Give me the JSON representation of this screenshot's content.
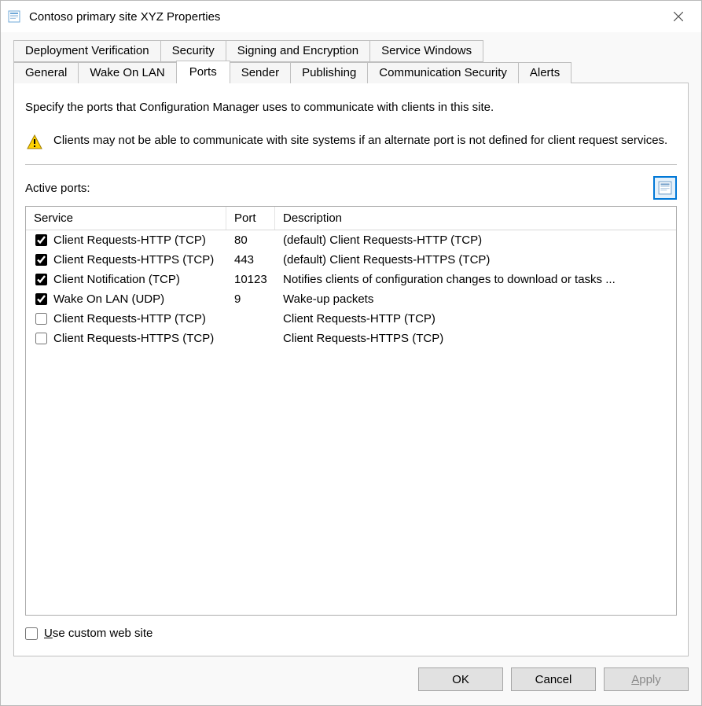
{
  "window": {
    "title": "Contoso primary site XYZ Properties"
  },
  "tabs": {
    "row_top": [
      {
        "label": "Deployment Verification"
      },
      {
        "label": "Security"
      },
      {
        "label": "Signing and Encryption"
      },
      {
        "label": "Service Windows"
      }
    ],
    "row_active": [
      {
        "label": "General"
      },
      {
        "label": "Wake On LAN"
      },
      {
        "label": "Ports",
        "active": true
      },
      {
        "label": "Sender"
      },
      {
        "label": "Publishing"
      },
      {
        "label": "Communication Security"
      },
      {
        "label": "Alerts"
      }
    ]
  },
  "page": {
    "instruction": "Specify the ports that Configuration Manager uses to communicate with clients in this site.",
    "warning": "Clients may not be able to communicate with site systems if an alternate port is not defined for client request services.",
    "active_ports_label": "Active ports:",
    "columns": {
      "service": "Service",
      "port": "Port",
      "description": "Description"
    },
    "rows": [
      {
        "checked": true,
        "service": "Client Requests-HTTP (TCP)",
        "port": "80",
        "description": "(default) Client Requests-HTTP (TCP)"
      },
      {
        "checked": true,
        "service": "Client Requests-HTTPS (TCP)",
        "port": "443",
        "description": "(default) Client Requests-HTTPS (TCP)"
      },
      {
        "checked": true,
        "service": "Client Notification (TCP)",
        "port": "10123",
        "description": "Notifies clients of configuration changes to download or tasks ..."
      },
      {
        "checked": true,
        "service": "Wake On LAN (UDP)",
        "port": "9",
        "description": "Wake-up packets"
      },
      {
        "checked": false,
        "service": "Client Requests-HTTP (TCP)",
        "port": "",
        "description": "Client Requests-HTTP (TCP)"
      },
      {
        "checked": false,
        "service": "Client Requests-HTTPS (TCP)",
        "port": "",
        "description": "Client Requests-HTTPS (TCP)"
      }
    ],
    "use_custom_label_pre": "U",
    "use_custom_label_rest": "se custom web site"
  },
  "buttons": {
    "ok": "OK",
    "cancel": "Cancel",
    "apply_pre": "A",
    "apply_rest": "pply"
  }
}
